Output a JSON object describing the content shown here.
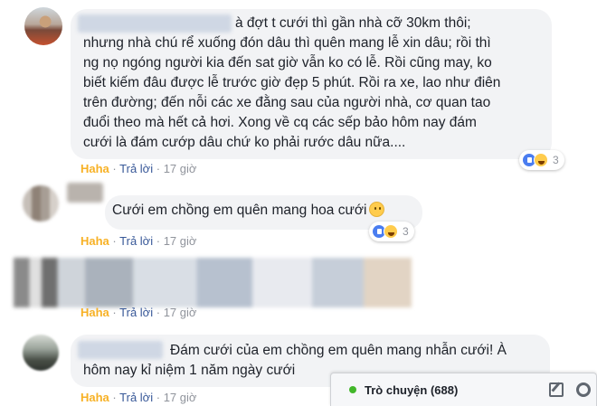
{
  "comments": [
    {
      "lines": [
        "à đợt t cưới thì gần nhà cỡ 30km thôi;",
        "nhưng nhà chú rể xuống đón dâu thì quên mang lễ xin dâu; rồi thì",
        "ng nọ ngóng người kia đến sat giờ vẫn ko có lễ. Rồi cũng may, ko",
        "biết kiếm đâu được lễ trước giờ đẹp 5 phút. Rồi ra xe, lao như điên",
        "trên đường; đến nỗi các xe đằng sau của người nhà, cơ quan tao",
        "đuổi theo mà hết cả hơi. Xong về cq các sếp bảo hôm nay đám",
        "cưới là đám cướp dâu chứ ko phải rước dâu nữa...."
      ],
      "reaction_count": "3",
      "haha": "Haha",
      "reply": "Trả lời",
      "time": "17 giờ"
    },
    {
      "text": "Cưới em chồng em quên mang hoa cưới",
      "reaction_count": "3",
      "haha": "Haha",
      "reply": "Trả lời",
      "time": "17 giờ"
    },
    {
      "haha": "Haha",
      "reply": "Trả lời",
      "time": "17 giờ"
    },
    {
      "lines": [
        "Đám cưới của em chồng em quên mang nhẫn cưới! À",
        "hôm nay kỉ niệm 1 năm ngày cưới"
      ],
      "haha": "Haha",
      "reply": "Trả lời",
      "time": "17 giờ"
    }
  ],
  "separator": "·",
  "chat_bar": {
    "label": "Trò chuyện (688)"
  },
  "icons": [
    "online-dot-icon",
    "compose-icon",
    "gear-icon",
    "like-reaction-icon",
    "haha-reaction-icon",
    "slightly-frowning-emoji-icon"
  ],
  "colors": {
    "haha": "#f7b125",
    "link": "#385898",
    "meta": "#90949c",
    "online": "#42b72a",
    "bubble": "#f2f3f5"
  }
}
